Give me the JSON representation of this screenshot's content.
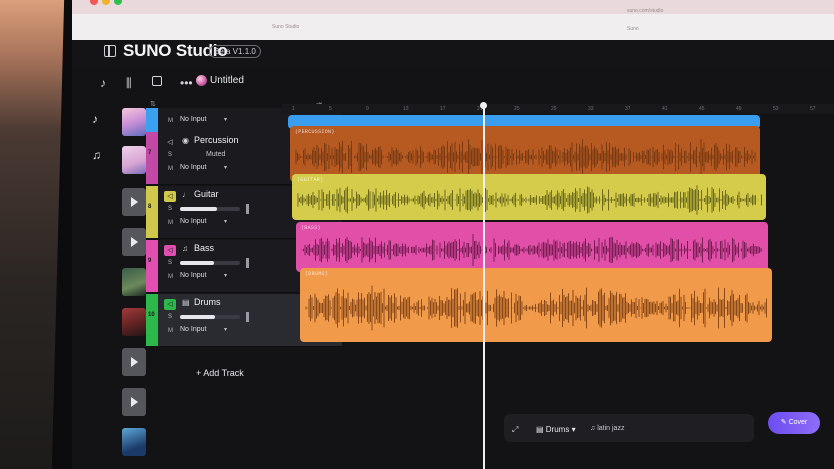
{
  "browser": {
    "tab_text": "Suno Studio",
    "url_text": "suno.com/studio",
    "bookmark_text": "Suno"
  },
  "header": {
    "title": "SUNO Studio",
    "badge": "Beta V1.1.0"
  },
  "toolbar": {
    "project_name": "Untitled",
    "icons": [
      "music-note-icon",
      "library-icon",
      "image-icon",
      "more-icon"
    ]
  },
  "sidebar": {
    "icons": [
      "music-note-icon",
      "double-note-icon"
    ]
  },
  "tracks": [
    {
      "number": "",
      "name": "",
      "color": "#3aa0f0",
      "input": "No Input",
      "muted": false,
      "icon": "none"
    },
    {
      "number": "7",
      "name": "Percussion",
      "color": "#c24aa6",
      "input": "No Input",
      "muted": true,
      "muted_label": "Muted",
      "icon": "drum-icon"
    },
    {
      "number": "8",
      "name": "Guitar",
      "color": "#cfc84a",
      "input": "No Input",
      "muted": false,
      "icon": "guitar-icon"
    },
    {
      "number": "9",
      "name": "Bass",
      "color": "#e04fb0",
      "input": "No Input",
      "muted": false,
      "icon": "bass-icon"
    },
    {
      "number": "10",
      "name": "Drums",
      "color": "#2cb84a",
      "input": "No Input",
      "muted": false,
      "icon": "drums-icon"
    }
  ],
  "track_controls": {
    "solo_letter": "S",
    "mute_letter": "M"
  },
  "add_track_label": "Add Track",
  "timeline": {
    "ruler_ticks": [
      "1",
      "5",
      "9",
      "13",
      "17",
      "21",
      "25",
      "29",
      "33",
      "37",
      "41",
      "45",
      "49",
      "53",
      "57"
    ],
    "clips": [
      {
        "track": "top",
        "label": "",
        "color": "#3a9ef0",
        "wave": "#3a9ef0"
      },
      {
        "track": "percussion",
        "label": "(PERCUSSION)",
        "color": "#b65a22",
        "wave": "#7a3a12"
      },
      {
        "track": "guitar",
        "label": "(GUITAR)",
        "color": "#d4cc4a",
        "wave": "#6e6a1c"
      },
      {
        "track": "bass",
        "label": "(BASS)",
        "color": "#e24fa8",
        "wave": "#7a1e56"
      },
      {
        "track": "drums",
        "label": "(DRUMS)",
        "color": "#f09a4a",
        "wave": "#8a4a1a"
      }
    ]
  },
  "bottom": {
    "track_select": "Drums",
    "style_text": "latin jazz",
    "create_label": "Cover"
  }
}
